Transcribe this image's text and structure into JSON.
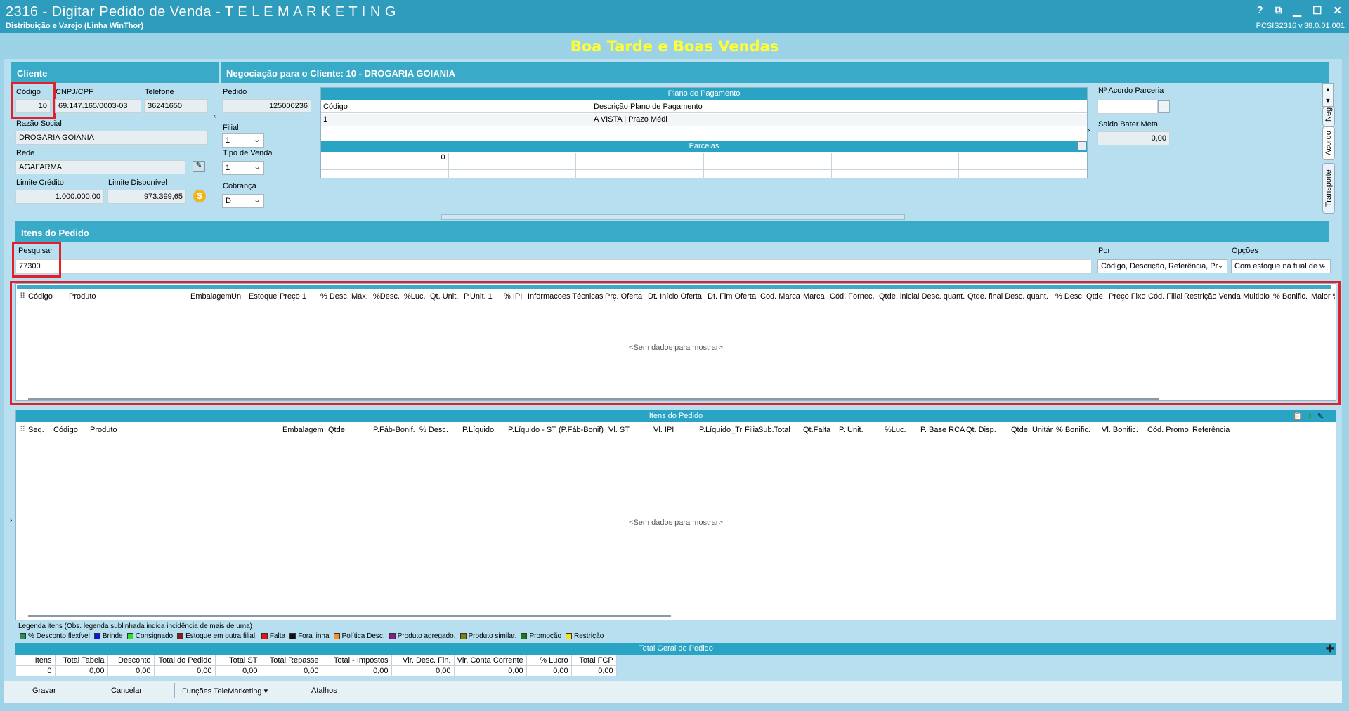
{
  "window": {
    "title": "2316 - Digitar Pedido de Venda - T E L E M A R K E T I N G",
    "subtitle": "Distribuição e Varejo (Linha WinThor)",
    "version": "PCSIS2316  v.38.0.01.001",
    "controls": [
      "?",
      "⧉",
      "▁",
      "☐",
      "✕"
    ]
  },
  "greeting": "Boa Tarde e Boas Vendas",
  "cliente": {
    "header": "Cliente",
    "codigo_label": "Código",
    "codigo": "10",
    "cnpj_label": "CNPJ/CPF",
    "cnpj": "69.147.165/0003-03",
    "telefone_label": "Telefone",
    "telefone": "36241650",
    "razao_label": "Razão Social",
    "razao": "DROGARIA GOIANIA",
    "rede_label": "Rede",
    "rede": "AGAFARMA",
    "limite_credito_label": "Limite Crédito",
    "limite_credito": "1.000.000,00",
    "limite_disponivel_label": "Limite Disponível",
    "limite_disponivel": "973.399,65"
  },
  "negociacao": {
    "header": "Negociação para o Cliente: 10 - DROGARIA GOIANIA",
    "pedido_label": "Pedido",
    "pedido": "125000236",
    "filial_label": "Filial",
    "filial": "1",
    "tipo_venda_label": "Tipo de Venda",
    "tipo_venda": "1",
    "cobranca_label": "Cobrança",
    "cobranca": "D",
    "plano": {
      "title": "Plano de Pagamento",
      "columns": [
        "Código",
        "Descrição Plano de Pagamento"
      ],
      "row": [
        "1",
        "A VISTA | Prazo Médi"
      ]
    },
    "parcelas": {
      "title": "Parcelas",
      "first_value": "0"
    },
    "acordo_label": "Nº Acordo Parceria",
    "saldo_label": "Saldo Bater Meta",
    "saldo": "0,00",
    "side_tabs": [
      "Neg",
      "Acordo",
      "Transporte"
    ]
  },
  "itens": {
    "header": "Itens do Pedido",
    "pesquisar_label": "Pesquisar",
    "pesquisar": "77300",
    "por_label": "Por",
    "por": "Código, Descrição, Referência, Pr",
    "opcoes_label": "Opções",
    "opcoes": "Com estoque na filial de v",
    "search_columns": [
      "Código",
      "Produto",
      "Embalagem",
      "Un.",
      "Estoque",
      "Preço 1",
      "% Desc. Máx.",
      "%Desc.",
      "%Luc.",
      "Qt. Unit.",
      "P.Unit. 1",
      "% IPI",
      "Informacoes Técnicas",
      "Prç. Oferta",
      "Dt. Início Oferta",
      "Dt. Fim Oferta",
      "Cod. Marca",
      "Marca",
      "Cód. Fornec.",
      "Qtde. inicial Desc. quant.",
      "Qtde. final Desc. quant.",
      "% Desc. Qtde.",
      "Preço Fixo",
      "Cód. Filial",
      "Restrição Venda",
      "Multiplo",
      "% Bonific.",
      "Maior %"
    ],
    "empty": "<Sem dados para mostrar>",
    "grid_title": "Itens do Pedido",
    "order_columns": [
      "Seq.",
      "Código",
      "Produto",
      "Embalagem",
      "Qtde",
      "P.Fáb-Bonif.",
      "% Desc.",
      "P.Líquido",
      "P.Líquido - ST",
      "(P.Fáb-Bonif)",
      "Vl. ST",
      "Vl. IPI",
      "P.Líquido_Tr",
      "Filia",
      "Sub.Total",
      "Qt.Falta",
      "P. Unit.",
      "%Luc.",
      "P. Base RCA",
      "Qt. Disp.",
      "Qtde. Unitár",
      "% Bonific.",
      "Vl. Bonific.",
      "Cód. Promo",
      "Referência"
    ]
  },
  "legenda": {
    "title": "Legenda itens (Obs. legenda sublinhada indica incidência de mais de uma)",
    "items": [
      {
        "label": "% Desconto flexível",
        "color": "#2e8b57"
      },
      {
        "label": "Brinde",
        "color": "#1515d6"
      },
      {
        "label": "Consignado",
        "color": "#33dd33"
      },
      {
        "label": "Estoque em outra filial.",
        "color": "#8b1a1a"
      },
      {
        "label": "Falta",
        "color": "#ee1111"
      },
      {
        "label": "Fora linha",
        "color": "#111111"
      },
      {
        "label": "Política Desc.",
        "color": "#f5921e"
      },
      {
        "label": "Produto agregado.",
        "color": "#8b1a8b"
      },
      {
        "label": "Produto similar.",
        "color": "#808000"
      },
      {
        "label": "Promoção",
        "color": "#1a7a1a"
      },
      {
        "label": "Restrição",
        "color": "#f3e21a"
      }
    ]
  },
  "totais": {
    "title": "Total Geral do Pedido",
    "headers": [
      "Itens",
      "Total Tabela",
      "Desconto",
      "Total do Pedido",
      "Total ST",
      "Total Repasse",
      "Total - Impostos",
      "Vlr. Desc. Fin.",
      "Vlr. Conta Corrente",
      "% Lucro",
      "Total FCP"
    ],
    "values": [
      "0",
      "0,00",
      "0,00",
      "0,00",
      "0,00",
      "0,00",
      "0,00",
      "0,00",
      "0,00",
      "0,00",
      "0,00"
    ]
  },
  "bottom": {
    "gravar": "Gravar",
    "cancelar": "Cancelar",
    "funcoes": "Funções TeleMarketing",
    "atalhos": "Atalhos"
  }
}
